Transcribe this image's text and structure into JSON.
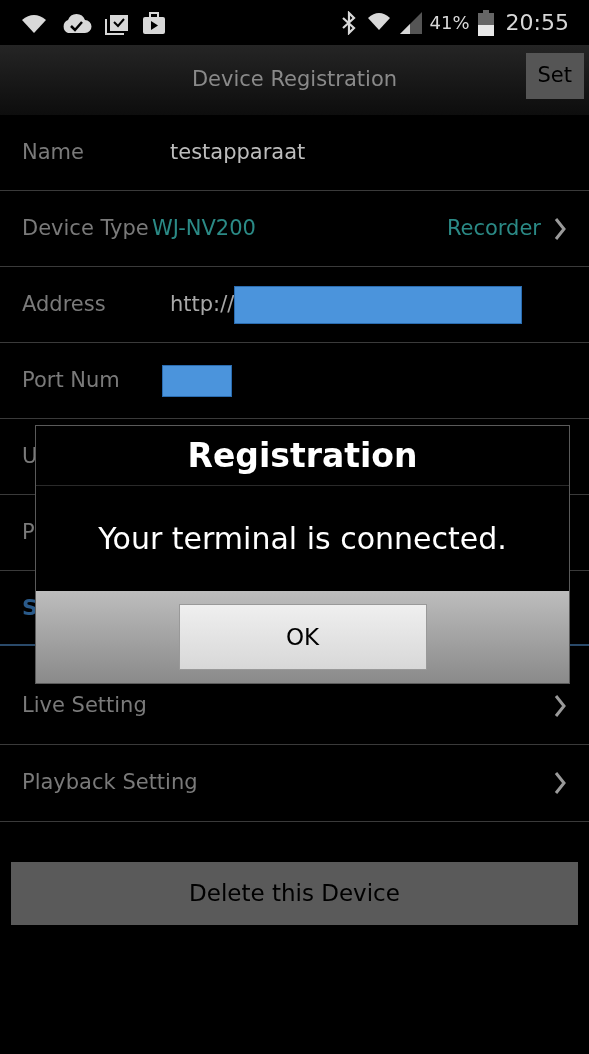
{
  "status_bar": {
    "battery": "41%",
    "time": "20:55"
  },
  "header": {
    "title": "Device Registration",
    "action": "Set"
  },
  "rows": [
    {
      "kind": "text",
      "label": "Name",
      "value": "testapparaat"
    },
    {
      "kind": "type",
      "label": "Device Type",
      "value": "WJ-NV200",
      "extra": "Recorder"
    },
    {
      "kind": "redacted",
      "label": "Address",
      "value": "http://"
    },
    {
      "kind": "redacted",
      "label": "Port Num"
    },
    {
      "kind": "text",
      "label": "U"
    },
    {
      "kind": "text",
      "label": "P"
    }
  ],
  "section": {
    "title": "S"
  },
  "links": [
    {
      "label": "Live Setting"
    },
    {
      "label": "Playback Setting"
    }
  ],
  "delete_button": "Delete this Device",
  "dialog": {
    "title": "Registration",
    "message": "Your terminal is connected.",
    "button": "OK"
  }
}
